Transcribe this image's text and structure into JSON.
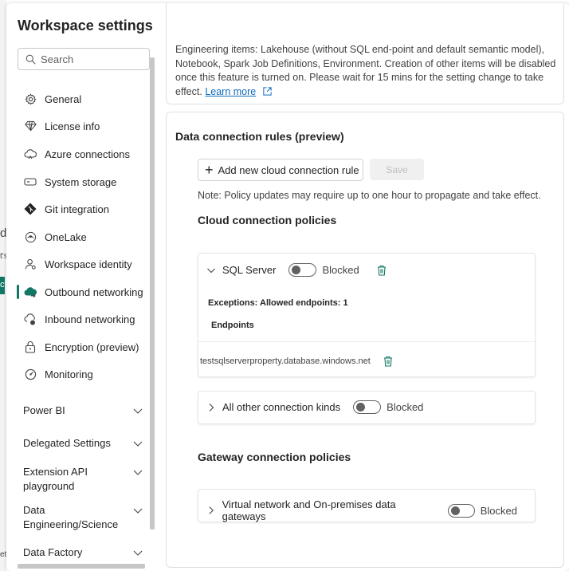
{
  "background": {
    "frag_d": "d",
    "frag_ts": "t's",
    "frag_ct": "ct",
    "frag_et": "et"
  },
  "window": {
    "title": "Workspace settings"
  },
  "search": {
    "placeholder": "Search"
  },
  "nav": {
    "items": [
      {
        "label": "General",
        "icon": "gear-icon"
      },
      {
        "label": "License info",
        "icon": "diamond-icon"
      },
      {
        "label": "Azure connections",
        "icon": "cloud-icon"
      },
      {
        "label": "System storage",
        "icon": "storage-icon"
      },
      {
        "label": "Git integration",
        "icon": "git-icon"
      },
      {
        "label": "OneLake",
        "icon": "onelake-icon"
      },
      {
        "label": "Workspace identity",
        "icon": "identity-icon"
      },
      {
        "label": "Outbound networking",
        "icon": "cloud-outbound-icon",
        "active": true
      },
      {
        "label": "Inbound networking",
        "icon": "inbound-icon"
      },
      {
        "label": "Encryption (preview)",
        "icon": "lock-icon"
      },
      {
        "label": "Monitoring",
        "icon": "monitoring-icon"
      }
    ],
    "sections": [
      "Power BI",
      "Delegated Settings",
      "Extension API playground",
      "Data Engineering/Science",
      "Data Factory"
    ]
  },
  "info": {
    "text": "Engineering items: Lakehouse (without SQL end-point and default semantic model), Notebook, Spark Job Definitions, Environment. Creation of other items will be disabled once this feature is turned on. Please wait for 15 mins for the setting change to take effect.",
    "learn_more": "Learn more"
  },
  "rules": {
    "heading": "Data connection rules (preview)",
    "add_button": "Add new cloud connection rule",
    "save_button": "Save",
    "note": "Note: Policy updates may require up to one hour to propagate and take effect.",
    "cloud_heading": "Cloud connection policies",
    "sql": {
      "label": "SQL Server",
      "state": "Blocked",
      "enabled": false,
      "exceptions": "Exceptions: Allowed endpoints: 1",
      "endpoints_heading": "Endpoints",
      "endpoint": "testsqlserverproperty.database.windows.net"
    },
    "others": {
      "label": "All other connection kinds",
      "state": "Blocked",
      "enabled": false
    },
    "gateway_heading": "Gateway connection policies",
    "gateway": {
      "label": "Virtual network and On-premises data gateways",
      "state": "Blocked",
      "enabled": false
    }
  },
  "colors": {
    "accent": "#117865",
    "link": "#0f6cbd"
  }
}
